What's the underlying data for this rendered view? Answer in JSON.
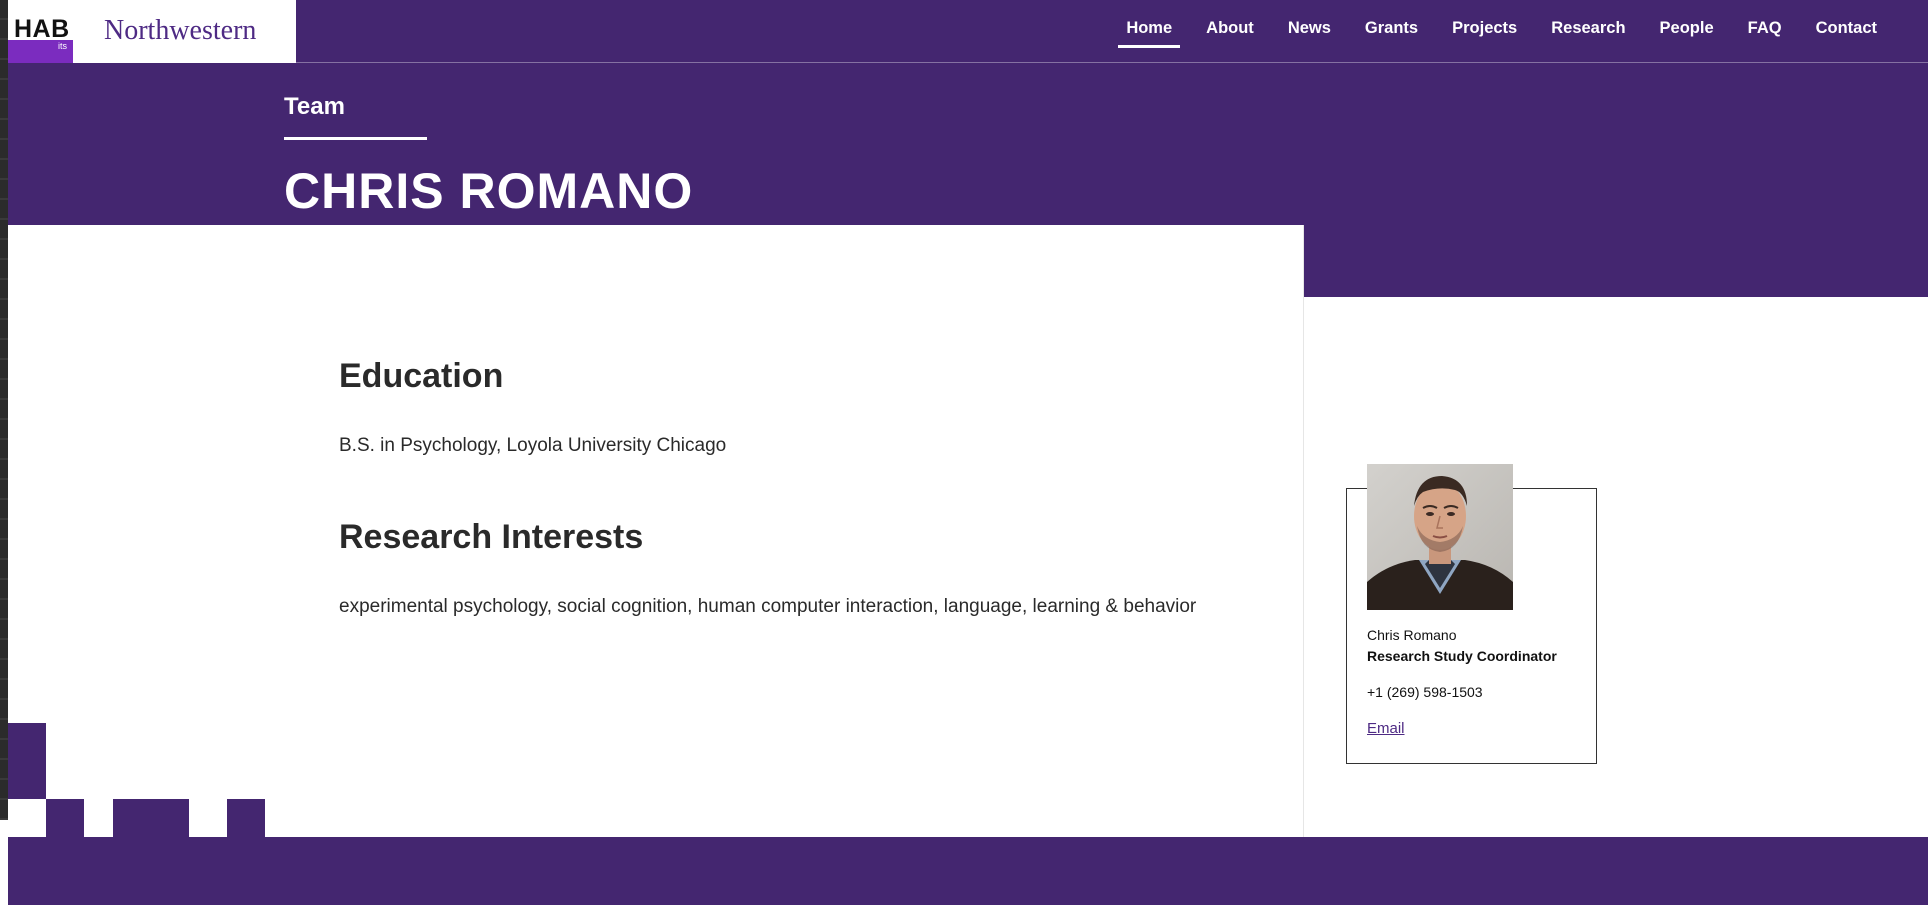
{
  "brand": {
    "hab_text": "HAB",
    "its_text": "its",
    "university": "Northwestern"
  },
  "nav": {
    "items": [
      {
        "label": "Home",
        "active": true
      },
      {
        "label": "About",
        "active": false
      },
      {
        "label": "News",
        "active": false
      },
      {
        "label": "Grants",
        "active": false
      },
      {
        "label": "Projects",
        "active": false
      },
      {
        "label": "Research",
        "active": false
      },
      {
        "label": "People",
        "active": false
      },
      {
        "label": "FAQ",
        "active": false
      },
      {
        "label": "Contact",
        "active": false
      }
    ]
  },
  "hero": {
    "breadcrumb": "Team",
    "title": "CHRIS ROMANO"
  },
  "education": {
    "heading": "Education",
    "text": "B.S. in Psychology, Loyola University Chicago"
  },
  "research": {
    "heading": "Research Interests",
    "text": "experimental psychology, social cognition, human computer interaction, language, learning & behavior"
  },
  "card": {
    "name": "Chris Romano",
    "role": "Research Study Coordinator",
    "phone": "+1 (269) 598-1503",
    "email_label": "Email"
  },
  "theme": {
    "primary": "#442670",
    "accent": "#7B2CBF",
    "link": "#4E2A84"
  }
}
